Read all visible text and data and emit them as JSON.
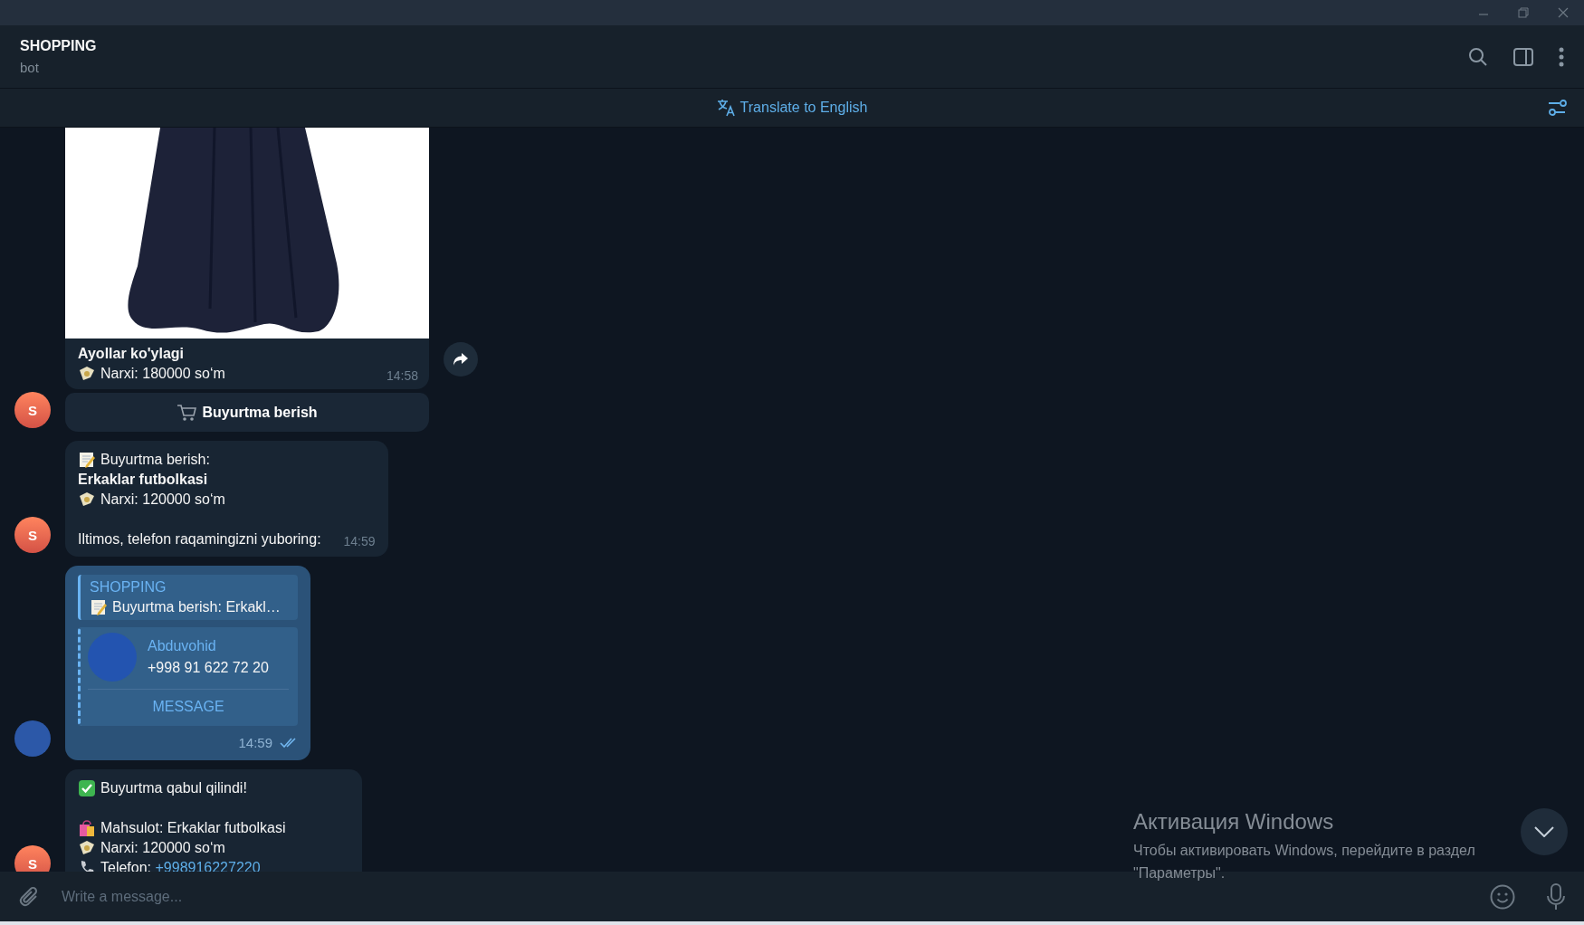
{
  "header": {
    "title": "SHOPPING",
    "subtitle": "bot"
  },
  "translate_bar": {
    "label": "Translate to English"
  },
  "messages": [
    {
      "kind": "product",
      "avatar": "S",
      "caption": "Ayollar ko'ylagi",
      "lines": [
        {
          "kind": "money",
          "text": "Narxi: 180000 so‘m"
        }
      ],
      "time": "14:58",
      "button": "Buyurtma berish"
    },
    {
      "kind": "text",
      "avatar": "S",
      "lines": [
        {
          "kind": "memo",
          "text": "Buyurtma berish:"
        },
        {
          "kind": "bold",
          "text": "Erkaklar futbolkasi"
        },
        {
          "kind": "money",
          "text": "Narxi: 120000 so‘m"
        },
        {
          "kind": "blank"
        },
        {
          "kind": "plain",
          "text": "Iltimos, telefon raqamingizni yuboring:"
        }
      ],
      "time": "14:59"
    },
    {
      "kind": "contact",
      "reply": {
        "author": "SHOPPING",
        "kind": "memo",
        "text": "Buyurtma berish: Erkakl…"
      },
      "contact": {
        "name": "Abduvohid",
        "phone": "+998 91 622 72 20",
        "action": "MESSAGE"
      },
      "time": "14:59",
      "read": true
    },
    {
      "kind": "text",
      "avatar": "S",
      "lines": [
        {
          "kind": "check",
          "text": "Buyurtma qabul qilindi!"
        },
        {
          "kind": "blank"
        },
        {
          "kind": "bag",
          "text": "Mahsulot: Erkaklar futbolkasi"
        },
        {
          "kind": "money",
          "text": "Narxi: 120000 so‘m"
        },
        {
          "kind": "phone",
          "text": "Telefon:",
          "link": "+998916227220"
        }
      ]
    }
  ],
  "os_overlay": {
    "title": "Активация Windows",
    "text": "Чтобы активировать Windows, перейдите в раздел \"Параметры\"."
  },
  "composer": {
    "placeholder": "Write a message..."
  }
}
